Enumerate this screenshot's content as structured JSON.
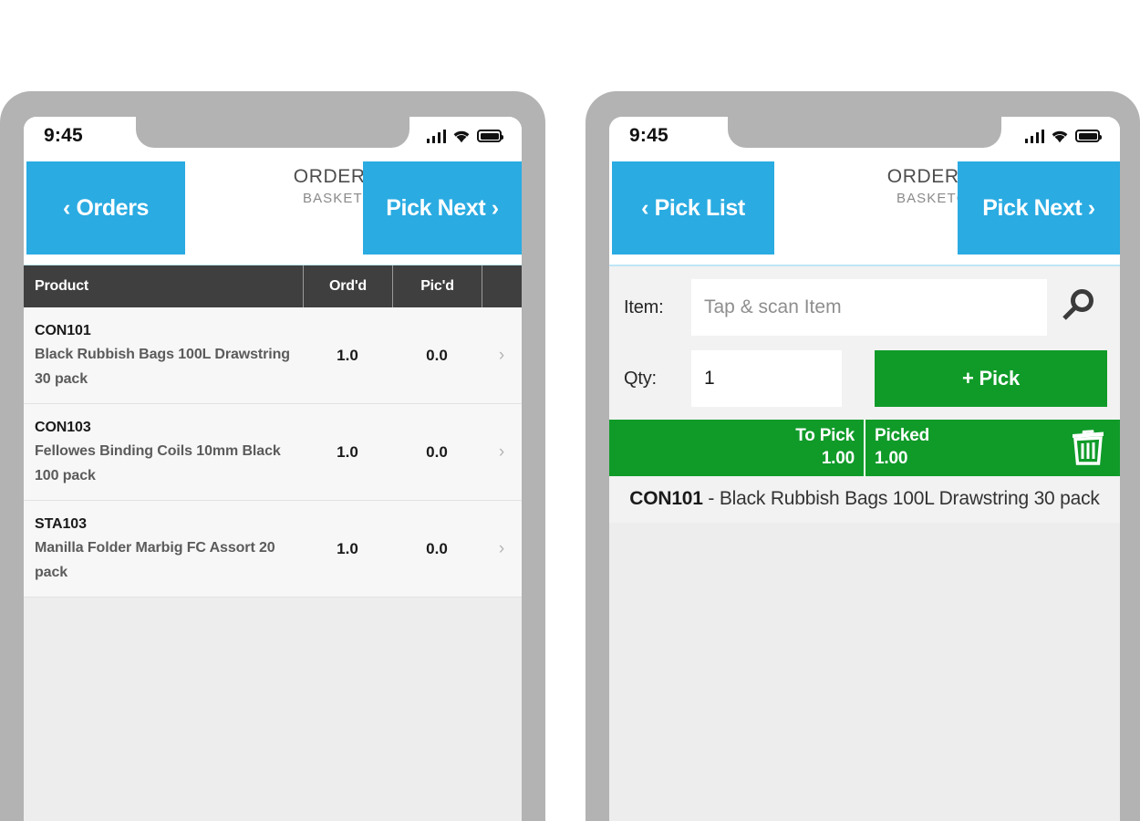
{
  "theme": {
    "blue": "#2aabe2",
    "green": "#109b29",
    "dark_header": "#3f3f3f",
    "frame_gray": "#b3b3b3",
    "screen_bg": "#ededed"
  },
  "phones": [
    {
      "id": "order-detail",
      "status_bar": {
        "time": "9:45",
        "icons": [
          "signal-icon",
          "wifi-icon",
          "battery-icon"
        ]
      },
      "navbar": {
        "back_label": "‹ Orders",
        "title_line1": "ORDER FOR",
        "title_line2": "BASKETCASE",
        "next_label": "Pick Next ›"
      },
      "table": {
        "columns": [
          "Product",
          "Ord'd",
          "Pic'd",
          ""
        ],
        "rows": [
          {
            "sku": "CON101",
            "description": "Black Rubbish Bags 100L Drawstring 30 pack",
            "ordered": "1.0",
            "picked": "0.0",
            "chevron": "›"
          },
          {
            "sku": "CON103",
            "description": "Fellowes Binding Coils 10mm Black 100 pack",
            "ordered": "1.0",
            "picked": "0.0",
            "chevron": "›"
          },
          {
            "sku": "STA103",
            "description": "Manilla Folder Marbig FC Assort 20 pack",
            "ordered": "1.0",
            "picked": "0.0",
            "chevron": "›"
          }
        ]
      }
    },
    {
      "id": "pick-item",
      "status_bar": {
        "time": "9:45",
        "icons": [
          "signal-icon",
          "wifi-icon",
          "battery-icon"
        ]
      },
      "navbar": {
        "back_label": "‹ Pick List",
        "title_line1": "ORDER FOR",
        "title_line2": "BASKETCASE",
        "next_label": "Pick Next ›"
      },
      "form": {
        "item_label": "Item:",
        "item_value": "",
        "item_placeholder": "Tap & scan Item",
        "search_icon": "search-icon",
        "qty_label": "Qty:",
        "qty_value": "1",
        "qty_placeholder": "",
        "pick_button": "+ Pick"
      },
      "summary": {
        "to_pick_label": "To Pick",
        "to_pick_value": "1.00",
        "picked_label": "Picked",
        "picked_value": "1.00",
        "delete_icon": "trash-icon"
      },
      "current_item": {
        "sku": "CON101",
        "separator": " - ",
        "description": "Black Rubbish Bags 100L Drawstring 30 pack"
      }
    }
  ]
}
